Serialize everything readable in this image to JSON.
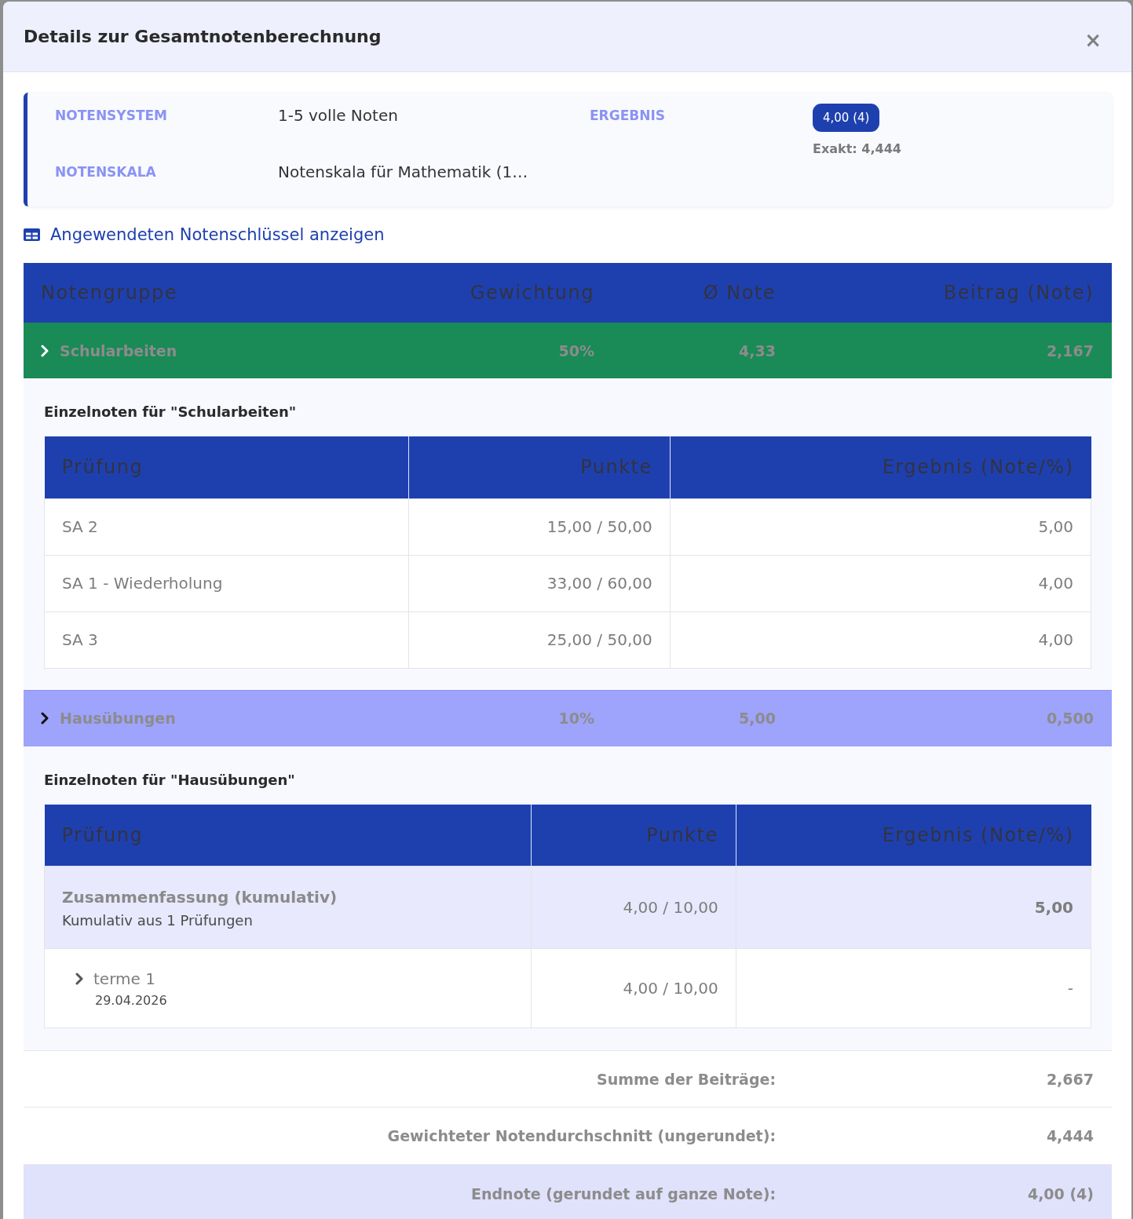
{
  "dialog": {
    "title": "Details zur Gesamtnotenberechnung",
    "close": "×"
  },
  "info": {
    "fields": [
      {
        "label": "NOTENSYSTEM",
        "value": "1-5 volle Noten"
      },
      {
        "label": "NOTENSKALA",
        "value": "Notenskala für Mathematik (1…"
      }
    ],
    "result": {
      "label": "ERGEBNIS",
      "badge": "4,00 (4)",
      "exact": "Exakt: 4,444"
    }
  },
  "key_link": "Angewendeten Notenschlüssel anzeigen",
  "groups_table": {
    "columns": [
      "Notengruppe",
      "Gewichtung",
      "Ø Note",
      "Beitrag (Note)"
    ],
    "groups": [
      {
        "name": "Schularbeiten",
        "weight": "50%",
        "average": "4,33",
        "contribution": "2,167",
        "color": "#1a8a56",
        "details": {
          "heading": "Einzelnoten für \"Schularbeiten\"",
          "columns": [
            "Prüfung",
            "Punkte",
            "Ergebnis (Note/%)"
          ],
          "rows": [
            {
              "kind": "plain",
              "exam": "SA 2",
              "points": "15,00 / 50,00",
              "result": "5,00"
            },
            {
              "kind": "plain",
              "exam": "SA 1 - Wiederholung",
              "points": "33,00 / 60,00",
              "result": "4,00"
            },
            {
              "kind": "plain",
              "exam": "SA 3",
              "points": "25,00 / 50,00",
              "result": "4,00"
            }
          ]
        }
      },
      {
        "name": "Hausübungen",
        "weight": "10%",
        "average": "5,00",
        "contribution": "0,500",
        "color": "#9ea3fb",
        "details": {
          "heading": "Einzelnoten für \"Hausübungen\"",
          "columns": [
            "Prüfung",
            "Punkte",
            "Ergebnis (Note/%)"
          ],
          "rows": [
            {
              "kind": "summary",
              "exam": "Zusammenfassung (kumulativ)",
              "note": "Kumulativ aus 1 Prüfungen",
              "points": "4,00 / 10,00",
              "result": "5,00"
            },
            {
              "kind": "nested",
              "exam": "terme 1",
              "date": "29.04.2026",
              "points": "4,00 / 10,00",
              "result": "-"
            }
          ]
        }
      }
    ]
  },
  "totals": [
    {
      "label": "Summe der Beiträge:",
      "value": "2,667",
      "highlighted": false
    },
    {
      "label": "Gewichteter Notendurchschnitt (ungerundet):",
      "value": "4,444",
      "highlighted": false
    },
    {
      "label": "Endnote (gerundet auf ganze Note):",
      "value": "4,00 (4)",
      "highlighted": true
    }
  ]
}
